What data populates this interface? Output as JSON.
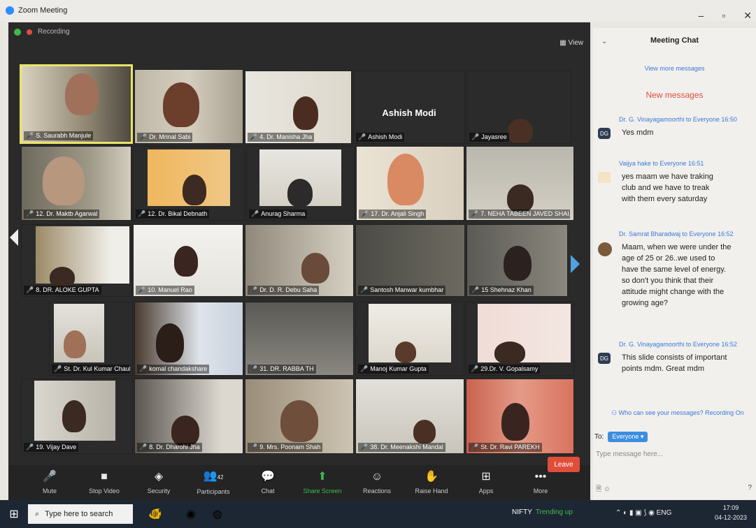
{
  "window": {
    "title": "Zoom Meeting",
    "minimize": "–",
    "maximize": "▫",
    "close": "✕"
  },
  "meeting": {
    "recording_label": "Recording",
    "view_label": "View",
    "featured_name": "Ashish Modi",
    "tiles": [
      {
        "name": "S. Saurabh Manjule"
      },
      {
        "name": "Dr. Mrinal Sabi"
      },
      {
        "name": "4. Dr. Manisha Jha"
      },
      {
        "name": "Ashish Modi"
      },
      {
        "name": "Jayasree"
      },
      {
        "name": "12. Dr. Maktb Agarwal"
      },
      {
        "name": "12. Dr. Bikal Debnath"
      },
      {
        "name": "Anurag Sharma"
      },
      {
        "name": "17. Dr. Anjali Singh"
      },
      {
        "name": "7. NEHA TABEEN JAVED SHAI..."
      },
      {
        "name": "8. DR. ALOKE GUPTA"
      },
      {
        "name": "10. Manuel Rao"
      },
      {
        "name": "Dr. D. R. Debu Saha"
      },
      {
        "name": "Santosh Manwar kumbhar"
      },
      {
        "name": "15 Shehnaz Khan"
      },
      {
        "name": "St. Dr. Kul Kumar Chauh..."
      },
      {
        "name": "komal chandakshare"
      },
      {
        "name": "31. DR. RABBA TH"
      },
      {
        "name": "Manoj Kumar Gupta"
      },
      {
        "name": "29.Dr. V. Gopalsamy"
      },
      {
        "name": "19. Vijay Dave"
      },
      {
        "name": "8. Dr. Dharohi Jha"
      },
      {
        "name": "9. Mrs. Poonam Shah"
      },
      {
        "name": "38. Dr. Meenakshi Mandal"
      },
      {
        "name": "St. Dr. Ravi PAREKH"
      }
    ]
  },
  "toolbar": {
    "items": [
      {
        "label": "Mute",
        "icon": "🎤"
      },
      {
        "label": "Stop Video",
        "icon": "■"
      },
      {
        "label": "Security",
        "icon": "◈"
      },
      {
        "label": "Participants",
        "icon": "👥"
      },
      {
        "label": "Chat",
        "icon": "💬"
      },
      {
        "label": "Share Screen",
        "icon": "⬆"
      },
      {
        "label": "Reactions",
        "icon": "☺"
      },
      {
        "label": "Raise Hand",
        "icon": "✋"
      },
      {
        "label": "Apps",
        "icon": "⊞"
      },
      {
        "label": "More",
        "icon": "•••"
      }
    ],
    "participants_count": "42",
    "leave_label": "Leave"
  },
  "chat": {
    "title": "Meeting Chat",
    "view_more": "View more messages",
    "new_messages": "New messages",
    "messages": [
      {
        "meta": "Dr. G. Vinayagamoorthi to Everyone 16:50",
        "text": "Yes mdm",
        "initials": "DG"
      },
      {
        "meta": "Vaijya hake to Everyone 16:51",
        "text": "yes maam we have traking club and we have to treak with them every saturday",
        "initials": ""
      },
      {
        "meta": "Dr. Samrat Bharadwaj to Everyone 16:52",
        "text": "Maam, when we were under the age of 25 or 26..we used to have the same level of energy. so don't you think that their attitude might change with the growing age?",
        "initials": ""
      },
      {
        "meta": "Dr. G. Vinayagamoorthi to Everyone 16:52",
        "text": "This slide consists of important points mdm. Great mdm",
        "initials": "DG"
      }
    ],
    "privacy": "Who can see your messages? Recording On",
    "to_label": "To:",
    "to_value": "Everyone ▾",
    "input_placeholder": "Type message here..."
  },
  "taskbar": {
    "search_placeholder": "Type here to search",
    "nifty": "NIFTY",
    "nifty_trend": "Trending up",
    "lang": "ENG",
    "time": "17:09",
    "date": "04-12-2023"
  }
}
